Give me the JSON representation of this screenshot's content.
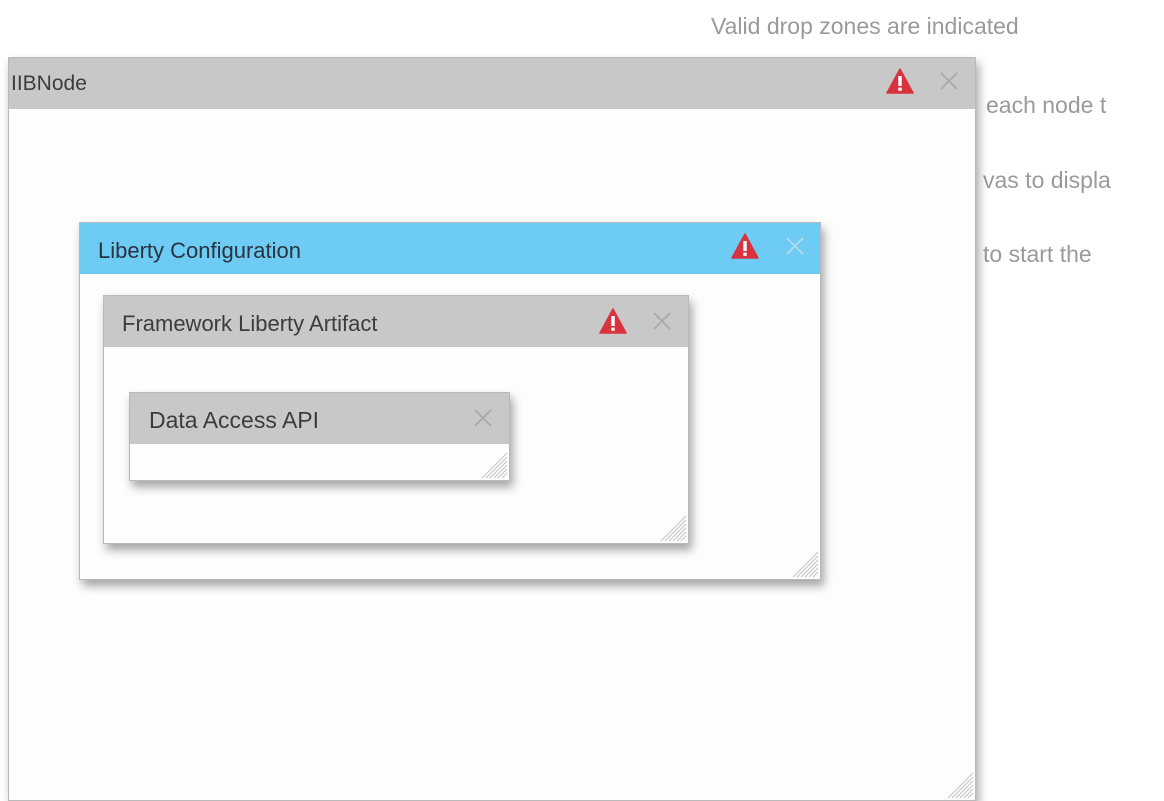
{
  "background_text": {
    "line1": "Valid drop zones are indicated",
    "line2": "each node t",
    "line3": "vas to displa",
    "line4": "to start the"
  },
  "nodes": {
    "iib_node": {
      "title": "IIBNode",
      "has_warning": true
    },
    "liberty_configuration": {
      "title": "Liberty Configuration",
      "has_warning": true,
      "selected": true
    },
    "framework_liberty_artifact": {
      "title": "Framework Liberty Artifact",
      "has_warning": true
    },
    "data_access_api": {
      "title": "Data Access API",
      "has_warning": false
    }
  },
  "colors": {
    "header_default": "#c8c8c8",
    "header_selected": "#6ecbf3",
    "warning_red": "#d9333f",
    "close_grey": "#a8a8a8",
    "background_text": "#9a9a9a"
  },
  "icons": {
    "warning": "warning-icon",
    "close": "close-icon",
    "resize": "resize-grip-icon"
  }
}
